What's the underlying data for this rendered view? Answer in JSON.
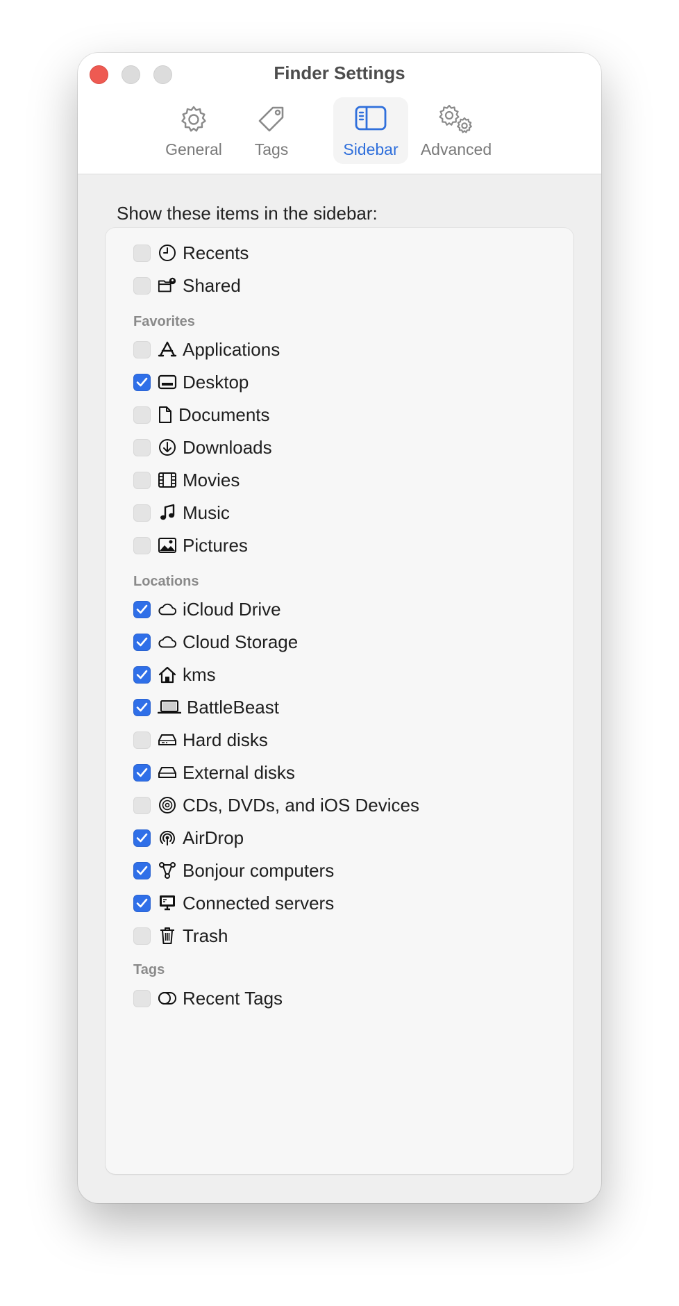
{
  "window": {
    "title": "Finder Settings"
  },
  "tabs": [
    {
      "label": "General",
      "icon": "gear-icon"
    },
    {
      "label": "Tags",
      "icon": "tag-icon"
    },
    {
      "label": "Sidebar",
      "icon": "sidebar-icon",
      "active": true
    },
    {
      "label": "Advanced",
      "icon": "gears-icon"
    }
  ],
  "prompt": "Show these items in the sidebar:",
  "sections": {
    "favorites": "Favorites",
    "locations": "Locations",
    "tags": "Tags"
  },
  "items": {
    "recents": {
      "label": "Recents",
      "checked": false
    },
    "shared": {
      "label": "Shared",
      "checked": false
    },
    "applications": {
      "label": "Applications",
      "checked": false
    },
    "desktop": {
      "label": "Desktop",
      "checked": true
    },
    "documents": {
      "label": "Documents",
      "checked": false
    },
    "downloads": {
      "label": "Downloads",
      "checked": false
    },
    "movies": {
      "label": "Movies",
      "checked": false
    },
    "music": {
      "label": "Music",
      "checked": false
    },
    "pictures": {
      "label": "Pictures",
      "checked": false
    },
    "icloud": {
      "label": "iCloud Drive",
      "checked": true
    },
    "cloud_storage": {
      "label": "Cloud Storage",
      "checked": true
    },
    "kms": {
      "label": "kms",
      "checked": true
    },
    "battlebeast": {
      "label": "BattleBeast",
      "checked": true
    },
    "hard_disks": {
      "label": "Hard disks",
      "checked": false
    },
    "external_disks": {
      "label": "External disks",
      "checked": true
    },
    "cds": {
      "label": "CDs, DVDs, and iOS Devices",
      "checked": false
    },
    "airdrop": {
      "label": "AirDrop",
      "checked": true
    },
    "bonjour": {
      "label": "Bonjour computers",
      "checked": true
    },
    "servers": {
      "label": "Connected servers",
      "checked": true
    },
    "trash": {
      "label": "Trash",
      "checked": false
    },
    "recent_tags": {
      "label": "Recent Tags",
      "checked": false
    }
  },
  "colors": {
    "accent": "#2f6fe8",
    "close": "#ee5a52"
  }
}
